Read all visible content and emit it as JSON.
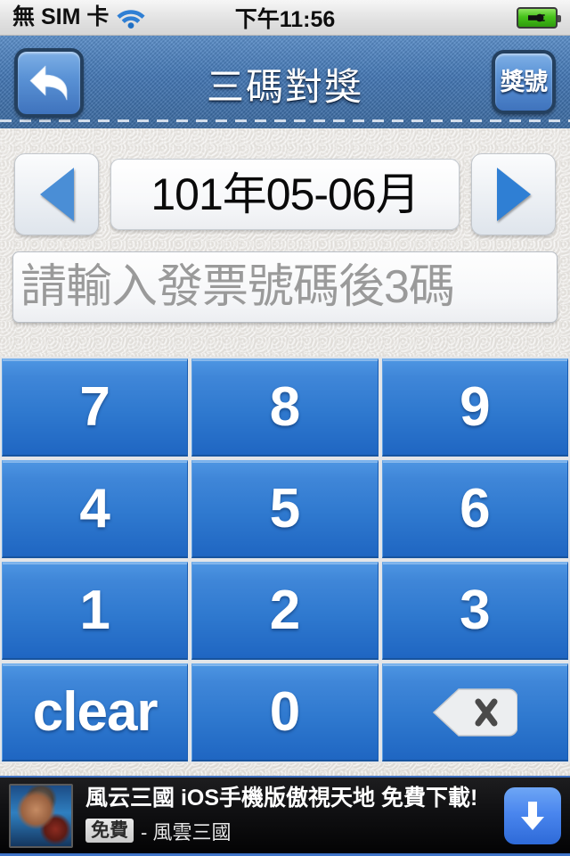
{
  "statusbar": {
    "carrier": "無 SIM 卡",
    "wifi_icon": "wifi-icon",
    "time": "下午11:56",
    "battery_icon": "battery-charging-icon"
  },
  "navbar": {
    "back_icon": "back-arrow-icon",
    "title": "三碼對獎",
    "right_button_label": "獎號"
  },
  "period": {
    "prev_icon": "triangle-left-icon",
    "value": "101年05-06月",
    "next_icon": "triangle-right-icon"
  },
  "input": {
    "value": "",
    "placeholder": "請輸入發票號碼後3碼"
  },
  "keypad": {
    "keys": [
      {
        "label": "7",
        "name": "key-7",
        "type": "digit"
      },
      {
        "label": "8",
        "name": "key-8",
        "type": "digit"
      },
      {
        "label": "9",
        "name": "key-9",
        "type": "digit"
      },
      {
        "label": "4",
        "name": "key-4",
        "type": "digit"
      },
      {
        "label": "5",
        "name": "key-5",
        "type": "digit"
      },
      {
        "label": "6",
        "name": "key-6",
        "type": "digit"
      },
      {
        "label": "1",
        "name": "key-1",
        "type": "digit"
      },
      {
        "label": "2",
        "name": "key-2",
        "type": "digit"
      },
      {
        "label": "3",
        "name": "key-3",
        "type": "digit"
      },
      {
        "label": "clear",
        "name": "key-clear",
        "type": "word"
      },
      {
        "label": "0",
        "name": "key-0",
        "type": "digit"
      },
      {
        "label": "",
        "name": "key-backspace",
        "type": "backspace-icon"
      }
    ]
  },
  "ad": {
    "thumbnail": "game-character-thumbnail",
    "title": "風云三國 iOS手機版傲視天地 免費下載!",
    "badge": "免費",
    "advertiser": "- 風雲三國",
    "download_icon": "download-arrow-icon"
  },
  "colors": {
    "navbar_blue": "#4276b4",
    "key_blue": "#2f79cf",
    "accent_blue": "#3f74c8",
    "battery_green": "#46c11a",
    "placeholder_gray": "#9a9a9a"
  }
}
